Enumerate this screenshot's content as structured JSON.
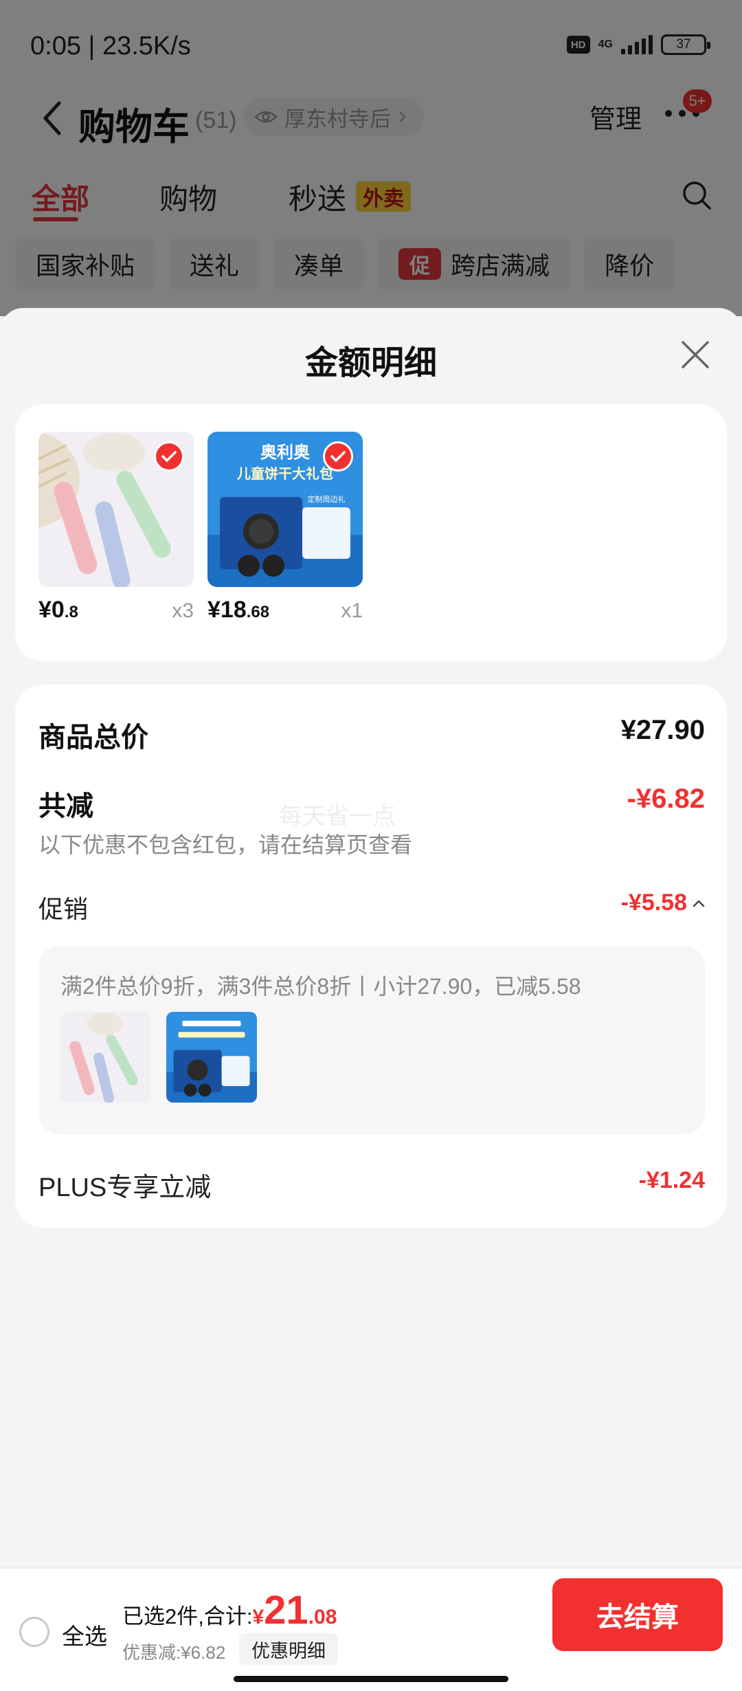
{
  "status_bar": {
    "time": "0:05 | 23.5K/s",
    "hd": "HD",
    "network": "4G",
    "battery": "37"
  },
  "header": {
    "title": "购物车",
    "count": "(51)",
    "location": "厚东村寺后",
    "manage": "管理",
    "badge": "5+"
  },
  "tabs": [
    {
      "label": "全部",
      "active": true
    },
    {
      "label": "购物",
      "active": false
    },
    {
      "label": "秒送",
      "active": false
    }
  ],
  "tab_badge": "外卖",
  "chips": [
    {
      "label": "国家补贴"
    },
    {
      "label": "送礼"
    },
    {
      "label": "凑单"
    },
    {
      "label": "跨店满减",
      "tag": "促"
    },
    {
      "label": "降价"
    }
  ],
  "sheet": {
    "title": "金额明细",
    "items": [
      {
        "price_int": "¥0",
        "price_dec": ".8",
        "qty": "x3"
      },
      {
        "price_int": "¥18",
        "price_dec": ".68",
        "qty": "x1"
      }
    ],
    "oreo_box": {
      "brand": "奥利奥",
      "headline": "儿童饼干大礼包",
      "sub": "定制周边礼"
    },
    "total_label": "商品总价",
    "total_value": "¥27.90",
    "reduce_label": "共减",
    "reduce_value": "-¥6.82",
    "reduce_note": "以下优惠不包含红包，请在结算页查看",
    "watermark": "每天省一点",
    "promo_label": "促销",
    "promo_value": "-¥5.58",
    "promo_desc": "满2件总价9折，满3件总价8折丨小计27.90，已减5.58",
    "plus_label": "PLUS专享立减",
    "plus_value": "-¥1.24"
  },
  "bottom": {
    "select_all": "全选",
    "selected_text": "已选2件,合计:",
    "total_currency": "¥",
    "total_int": "21",
    "total_dec": ".08",
    "discount_text": "优惠减:¥6.82",
    "discount_btn": "优惠明细",
    "checkout": "去结算"
  },
  "colors": {
    "accent": "#f23030",
    "tab_active": "#e4393c",
    "takeout_badge": "#ffd33a"
  }
}
